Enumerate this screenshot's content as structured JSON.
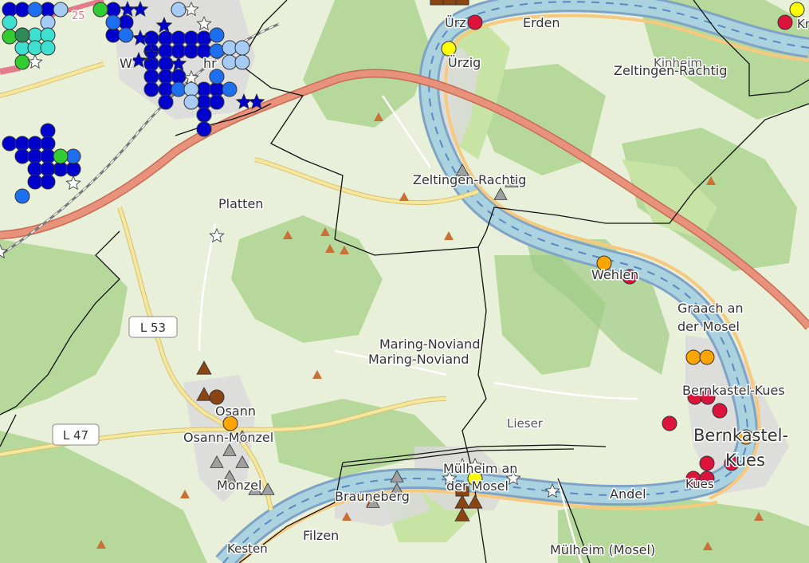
{
  "map": {
    "place_labels": [
      {
        "id": "uerzig-top",
        "text": "Ürz"
      },
      {
        "id": "erden",
        "text": "Erden"
      },
      {
        "id": "uerzig",
        "text": "Ürzig"
      },
      {
        "id": "kinheim",
        "text": "Kinheim"
      },
      {
        "id": "zeltingen-rachtig-ne",
        "text": "Zeltingen-Rachtig"
      },
      {
        "id": "zeltingen-rachtig",
        "text": "Zeltingen-Rachtig"
      },
      {
        "id": "platten",
        "text": "Platten"
      },
      {
        "id": "wehlen",
        "text": "Wehlen"
      },
      {
        "id": "graach-1",
        "text": "Graach an"
      },
      {
        "id": "graach-2",
        "text": "der Mosel"
      },
      {
        "id": "maring-noviand-1",
        "text": "Maring-Noviand"
      },
      {
        "id": "maring-noviand-2",
        "text": "Maring-Noviand"
      },
      {
        "id": "bernkastel-kues",
        "text": "Bernkastel-Kues"
      },
      {
        "id": "bernkastel-big",
        "text": "Bernkastel-"
      },
      {
        "id": "kues-big",
        "text": "Kues"
      },
      {
        "id": "kues-small",
        "text": "Kues"
      },
      {
        "id": "osann",
        "text": "Osann"
      },
      {
        "id": "osann-monzel",
        "text": "Osann-Monzel"
      },
      {
        "id": "lieser",
        "text": "Lieser"
      },
      {
        "id": "muelheim-an",
        "text": "Mülheim an"
      },
      {
        "id": "der-mosel",
        "text": "der Mosel"
      },
      {
        "id": "monzel",
        "text": "Monzel"
      },
      {
        "id": "brauneberg",
        "text": "Brauneberg"
      },
      {
        "id": "andel",
        "text": "Andel"
      },
      {
        "id": "filzen",
        "text": "Filzen"
      },
      {
        "id": "kesten",
        "text": "Kesten"
      },
      {
        "id": "muelheim-mosel",
        "text": "Mülheim (Mosel)"
      },
      {
        "id": "wittlich",
        "text": "W"
      },
      {
        "id": "wittlich-2",
        "text": "hr"
      },
      {
        "id": "kr",
        "text": "Kr"
      }
    ],
    "road_labels": [
      {
        "id": "l53",
        "text": "L 53"
      },
      {
        "id": "l47",
        "text": "L 47"
      },
      {
        "id": "road-25",
        "text": "25"
      }
    ],
    "colors": {
      "land": "#e9f0d9",
      "forest": "#b6d99b",
      "forest_dark": "#9fcb88",
      "vineyard": "#c7e4a5",
      "river": "#aad3df",
      "river_edge": "#7fa3c7",
      "motorway": "#e8927c",
      "primary_road": "#f5e79b",
      "boundary": "#111111",
      "marker_red": "#dc143c",
      "marker_orange": "#ffa500",
      "marker_yellow": "#ffff00",
      "marker_navy": "#0000cd",
      "marker_blue": "#1e6ff0",
      "marker_lightblue": "#a6ccf5",
      "marker_teal": "#40e0d0",
      "marker_green": "#32cd32",
      "marker_brown": "#8b4513",
      "marker_gray": "#a0a0a0",
      "marker_white": "#ffffff",
      "peak": "#c87137"
    }
  }
}
